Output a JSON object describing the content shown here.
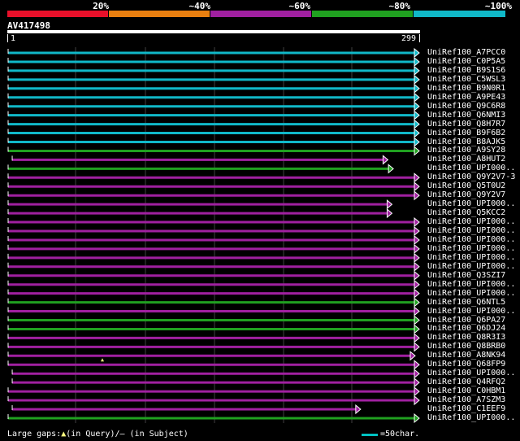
{
  "legend": {
    "labels": [
      "20%",
      "~40%",
      "~60%",
      "~80%",
      "~100%"
    ],
    "colors": [
      "#e8102a",
      "#e87f10",
      "#a020a0",
      "#20a020",
      "#10b8c8"
    ]
  },
  "query": {
    "name": "AV417498",
    "start": "1",
    "end": "299"
  },
  "colors": {
    "cyan": "#10b8c8",
    "green": "#20a020",
    "purple": "#a020a0"
  },
  "hits": [
    {
      "name": "UniRef100_A7PCC0",
      "color": "cyan",
      "start": 1,
      "end": 299
    },
    {
      "name": "UniRef100_C0P5A5",
      "color": "cyan",
      "start": 1,
      "end": 299
    },
    {
      "name": "UniRef100_B9S1S6",
      "color": "cyan",
      "start": 1,
      "end": 299
    },
    {
      "name": "UniRef100_C5WSL3",
      "color": "cyan",
      "start": 1,
      "end": 299
    },
    {
      "name": "UniRef100_B9N0R1",
      "color": "cyan",
      "start": 1,
      "end": 299
    },
    {
      "name": "UniRef100_A9PE43",
      "color": "cyan",
      "start": 1,
      "end": 299
    },
    {
      "name": "UniRef100_Q9C6R8",
      "color": "cyan",
      "start": 1,
      "end": 299
    },
    {
      "name": "UniRef100_Q6NMI3",
      "color": "cyan",
      "start": 1,
      "end": 299
    },
    {
      "name": "UniRef100_Q8H7R7",
      "color": "cyan",
      "start": 1,
      "end": 299
    },
    {
      "name": "UniRef100_B9F6B2",
      "color": "cyan",
      "start": 1,
      "end": 299
    },
    {
      "name": "UniRef100_B8AJK5",
      "color": "cyan",
      "start": 1,
      "end": 299
    },
    {
      "name": "UniRef100_A9SY28",
      "color": "green",
      "start": 1,
      "end": 299
    },
    {
      "name": "UniRef100_A8HUT2",
      "color": "purple",
      "start": 4,
      "end": 276
    },
    {
      "name": "UniRef100_UPI000..",
      "color": "green",
      "start": 1,
      "end": 280
    },
    {
      "name": "UniRef100_Q9Y2V7-3",
      "color": "purple",
      "start": 1,
      "end": 299
    },
    {
      "name": "UniRef100_Q5T0U2",
      "color": "purple",
      "start": 1,
      "end": 299
    },
    {
      "name": "UniRef100_Q9Y2V7",
      "color": "purple",
      "start": 1,
      "end": 299
    },
    {
      "name": "UniRef100_UPI000..",
      "color": "purple",
      "start": 1,
      "end": 279
    },
    {
      "name": "UniRef100_Q5KCC2",
      "color": "purple",
      "start": 1,
      "end": 279
    },
    {
      "name": "UniRef100_UPI000..",
      "color": "purple",
      "start": 1,
      "end": 299
    },
    {
      "name": "UniRef100_UPI000..",
      "color": "purple",
      "start": 1,
      "end": 299
    },
    {
      "name": "UniRef100_UPI000..",
      "color": "purple",
      "start": 1,
      "end": 299
    },
    {
      "name": "UniRef100_UPI000..",
      "color": "purple",
      "start": 1,
      "end": 299
    },
    {
      "name": "UniRef100_UPI000..",
      "color": "purple",
      "start": 1,
      "end": 299
    },
    {
      "name": "UniRef100_UPI000..",
      "color": "purple",
      "start": 1,
      "end": 299
    },
    {
      "name": "UniRef100_Q3SZI7",
      "color": "purple",
      "start": 1,
      "end": 299
    },
    {
      "name": "UniRef100_UPI000..",
      "color": "purple",
      "start": 1,
      "end": 299
    },
    {
      "name": "UniRef100_UPI000..",
      "color": "purple",
      "start": 1,
      "end": 299
    },
    {
      "name": "UniRef100_Q6NTL5",
      "color": "green",
      "start": 1,
      "end": 299
    },
    {
      "name": "UniRef100_UPI000..",
      "color": "purple",
      "start": 1,
      "end": 299
    },
    {
      "name": "UniRef100_Q6PA27",
      "color": "green",
      "start": 1,
      "end": 299
    },
    {
      "name": "UniRef100_Q6DJ24",
      "color": "green",
      "start": 1,
      "end": 299
    },
    {
      "name": "UniRef100_Q8R3I3",
      "color": "purple",
      "start": 1,
      "end": 299
    },
    {
      "name": "UniRef100_Q8BRB0",
      "color": "purple",
      "start": 1,
      "end": 299
    },
    {
      "name": "UniRef100_A8NK94",
      "color": "purple",
      "start": 1,
      "end": 296,
      "gap_query": true
    },
    {
      "name": "UniRef100_Q68FP9",
      "color": "purple",
      "start": 1,
      "end": 299
    },
    {
      "name": "UniRef100_UPI000..",
      "color": "purple",
      "start": 4,
      "end": 299
    },
    {
      "name": "UniRef100_Q4RFQ2",
      "color": "purple",
      "start": 4,
      "end": 299
    },
    {
      "name": "UniRef100_C0HBM1",
      "color": "purple",
      "start": 1,
      "end": 299
    },
    {
      "name": "UniRef100_A7SZM3",
      "color": "purple",
      "start": 1,
      "end": 299
    },
    {
      "name": "UniRef100_C1EEF9",
      "color": "purple",
      "start": 4,
      "end": 256
    },
    {
      "name": "UniRef100_UPI000..",
      "color": "green",
      "start": 1,
      "end": 299
    }
  ],
  "footer": {
    "left_prefix": "Large gaps:",
    "query_gap_glyph": "▲",
    "left_suffix": "(in Query)/– (in Subject)",
    "scale_text": "=50char."
  }
}
